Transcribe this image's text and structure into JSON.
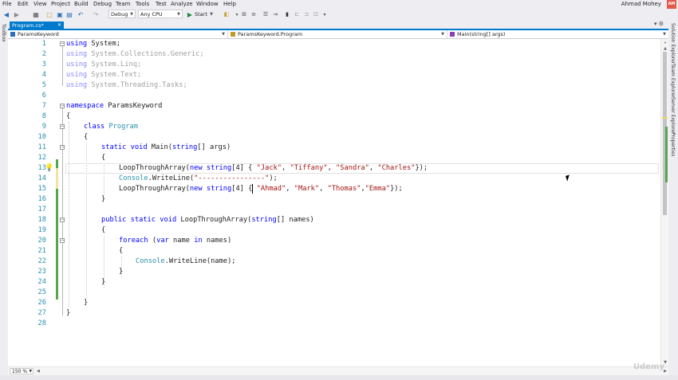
{
  "menu": [
    "File",
    "Edit",
    "View",
    "Project",
    "Build",
    "Debug",
    "Team",
    "Tools",
    "Test",
    "Analyze",
    "Window",
    "Help"
  ],
  "user": {
    "name": "Ahmad Mohey",
    "initials": "AM"
  },
  "toolbar": {
    "config": "Debug",
    "platform": "Any CPU",
    "start_label": "Start",
    "back_icon": "◀",
    "forward_icon": "▶",
    "start_icon": "▶",
    "undo_icon": "↶",
    "redo_icon": "↷",
    "save_icon": "▣",
    "saveall_icon": "▤",
    "open_icon": "□",
    "new_icon": "▦"
  },
  "toolbox_label": "Toolbox",
  "right_tabs": [
    "Solution Explorer",
    "Team Explorer",
    "Server Explorer",
    "Properties"
  ],
  "document_tab": {
    "label": "Program.cs*",
    "close": "✕"
  },
  "navbar": {
    "project": "ParamsKeyword",
    "class": "ParamsKeyword.Program",
    "member": "Main(string[] args)"
  },
  "editor": {
    "line_numbers": [
      "1",
      "2",
      "3",
      "4",
      "5",
      "6",
      "7",
      "8",
      "9",
      "10",
      "11",
      "12",
      "13",
      "14",
      "15",
      "16",
      "17",
      "18",
      "19",
      "20",
      "21",
      "22",
      "23",
      "24",
      "25",
      "26",
      "27",
      "28"
    ],
    "lines": {
      "l1_kw": "using",
      "l1_rest": " System;",
      "l2_kw": "using",
      "l2_rest": " System.Collections.Generic;",
      "l3_kw": "using",
      "l3_rest": " System.Linq;",
      "l4_kw": "using",
      "l4_rest": " System.Text;",
      "l5_kw": "using",
      "l5_rest": " System.Threading.Tasks;",
      "l7_kw": "namespace",
      "l7_rest": " ParamsKeyword",
      "l8": "{",
      "l9_kw": "class",
      "l9_ty": "Program",
      "l10": "{",
      "l11_kw1": "static",
      "l11_kw2": "void",
      "l11_name": "Main(",
      "l11_kw3": "string",
      "l11_rest": "[] args)",
      "l12": "{",
      "l13_a": "LoopThroughArray(",
      "l13_kw": "new",
      "l13_kw2": "string",
      "l13_b": "[4] { ",
      "l13_s1": "\"Jack\"",
      "l13_s2": "\"Tiffany\"",
      "l13_s3": "\"Sandra\"",
      "l13_s4": "\"Charles\"",
      "l13_c": "});",
      "l14_ty": "Console",
      "l14_a": ".WriteLine(",
      "l14_s": "\"----------------\"",
      "l14_b": ");",
      "l15_a": "LoopThroughArray(",
      "l15_kw": "new",
      "l15_kw2": "string",
      "l15_b": "[4] { ",
      "l15_s1": "\"Ahmad\"",
      "l15_s2": "\"Mark\"",
      "l15_s3": "\"Thomas\"",
      "l15_s4": "\"Emma\"",
      "l15_c": "});",
      "l16": "}",
      "l18_kw1": "public",
      "l18_kw2": "static",
      "l18_kw3": "void",
      "l18_name": "LoopThroughArray(",
      "l18_kw4": "string",
      "l18_rest": "[] names)",
      "l19": "{",
      "l20_kw": "foreach",
      "l20_a": " (",
      "l20_kw2": "var",
      "l20_b": " name ",
      "l20_kw3": "in",
      "l20_c": " names)",
      "l21": "{",
      "l22_ty": "Console",
      "l22_a": ".WriteLine(name);",
      "l23": "}",
      "l24": "}",
      "l26": "}",
      "l27": "}"
    },
    "lightbulb_icon": "💡"
  },
  "zoom": "150 %",
  "watermark": "Udemy"
}
